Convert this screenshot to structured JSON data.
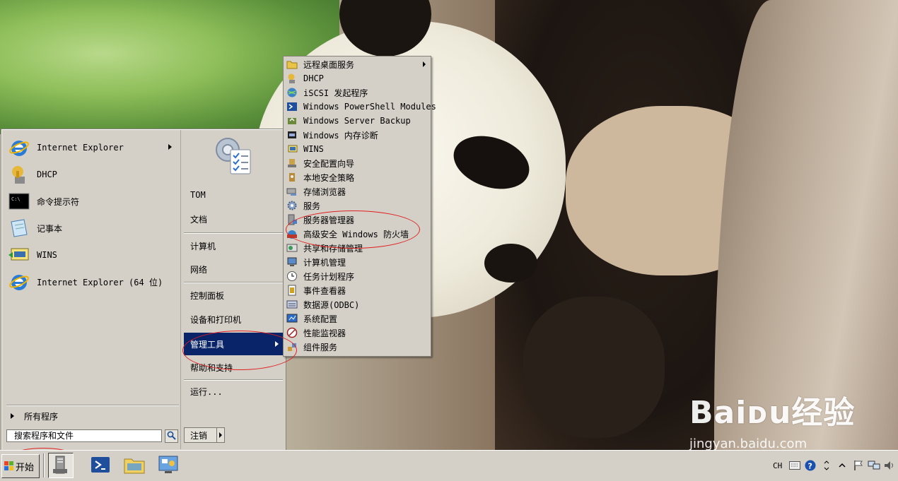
{
  "desktop": {
    "watermark": "Baiᴅu经验",
    "watermark_url": "jingyan.baidu.com"
  },
  "start_menu": {
    "pinned": [
      {
        "label": "Internet Explorer",
        "icon": "ie-icon",
        "has_submenu": true
      },
      {
        "label": "DHCP",
        "icon": "dhcp-icon",
        "has_submenu": false
      },
      {
        "label": "命令提示符",
        "icon": "cmd-icon",
        "has_submenu": false
      },
      {
        "label": "记事本",
        "icon": "notepad-icon",
        "has_submenu": false
      },
      {
        "label": "WINS",
        "icon": "wins-icon",
        "has_submenu": false
      },
      {
        "label": "Internet Explorer (64 位)",
        "icon": "ie-icon",
        "has_submenu": false
      }
    ],
    "all_programs": "所有程序",
    "search_placeholder": "搜索程序和文件",
    "right": {
      "user": "TOM",
      "documents": "文档",
      "computer": "计算机",
      "network": "网络",
      "control_panel": "控制面板",
      "devices": "设备和打印机",
      "admin_tools": "管理工具",
      "help": "帮助和支持",
      "run": "运行..."
    },
    "logoff": "注销"
  },
  "admin_submenu": [
    {
      "label": "远程桌面服务",
      "icon": "folder-icon",
      "has_submenu": true
    },
    {
      "label": "DHCP",
      "icon": "dhcp-icon"
    },
    {
      "label": "iSCSI 发起程序",
      "icon": "iscsi-globe-icon"
    },
    {
      "label": "Windows PowerShell Modules",
      "icon": "powershell-icon"
    },
    {
      "label": "Windows Server Backup",
      "icon": "backup-icon"
    },
    {
      "label": "Windows 内存诊断",
      "icon": "memory-diagnostic-icon"
    },
    {
      "label": "WINS",
      "icon": "wins-icon"
    },
    {
      "label": "安全配置向导",
      "icon": "security-wizard-icon"
    },
    {
      "label": "本地安全策略",
      "icon": "local-security-policy-icon"
    },
    {
      "label": "存储浏览器",
      "icon": "storage-explorer-icon"
    },
    {
      "label": "服务",
      "icon": "services-gear-icon"
    },
    {
      "label": "服务器管理器",
      "icon": "server-manager-icon"
    },
    {
      "label": "高级安全 Windows 防火墙",
      "icon": "firewall-icon"
    },
    {
      "label": "共享和存储管理",
      "icon": "share-storage-icon"
    },
    {
      "label": "计算机管理",
      "icon": "computer-management-icon"
    },
    {
      "label": "任务计划程序",
      "icon": "task-scheduler-clock-icon"
    },
    {
      "label": "事件查看器",
      "icon": "event-viewer-icon"
    },
    {
      "label": "数据源(ODBC)",
      "icon": "odbc-icon"
    },
    {
      "label": "系统配置",
      "icon": "system-config-icon"
    },
    {
      "label": "性能监视器",
      "icon": "performance-monitor-icon"
    },
    {
      "label": "组件服务",
      "icon": "component-services-icon"
    }
  ],
  "taskbar": {
    "start_label": "开始",
    "pinned_apps": [
      "server-manager-icon",
      "powershell-icon",
      "explorer-folder-icon",
      "control-panel-icon"
    ],
    "tray_lang": "CH",
    "tray_icons": [
      "keyboard-icon",
      "help-icon",
      "chevron-icon",
      "show-hidden-icon",
      "flag-icon",
      "network-icon",
      "volume-icon"
    ]
  },
  "colors": {
    "menu_bg": "#d4d0c8",
    "highlight": "#0a246a",
    "annotation": "#e02020"
  }
}
